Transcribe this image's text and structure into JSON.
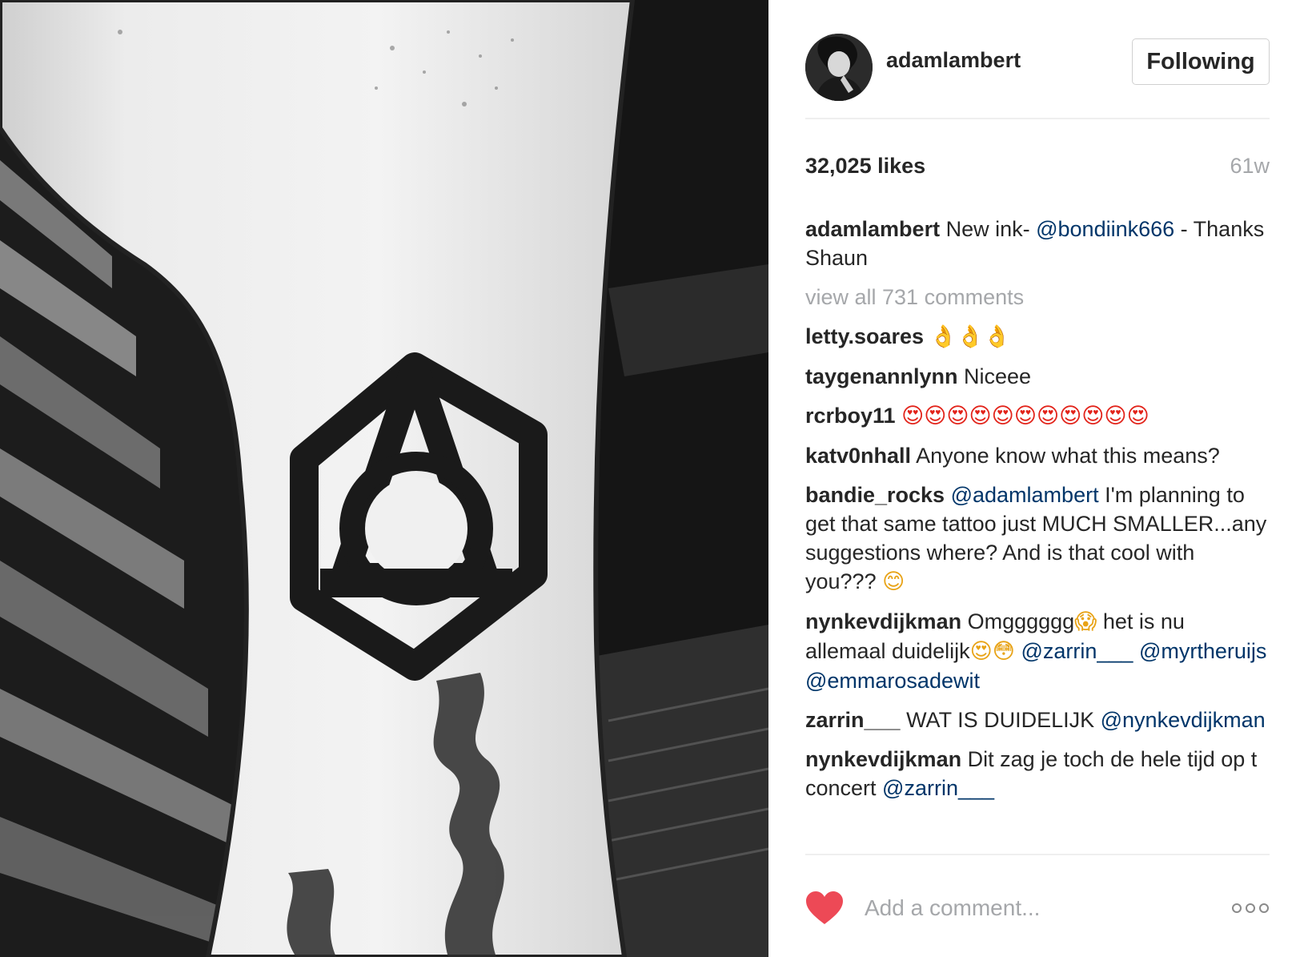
{
  "post": {
    "author": "adamlambert",
    "follow_label": "Following",
    "likes": "32,025 likes",
    "age": "61w",
    "caption": {
      "author": "adamlambert",
      "text_1": " New ink- ",
      "mention": "@bondiink666",
      "text_2": " - Thanks Shaun"
    },
    "view_all": "view all 731 comments"
  },
  "comments": [
    {
      "author": "letty.soares",
      "text": " ",
      "emoji": "👌👌👌"
    },
    {
      "author": "taygenannlynn",
      "text": " Niceee"
    },
    {
      "author": "rcrboy11",
      "text": " ",
      "emoji": "😍😍😍😍😍😍😍😍😍😍😍"
    },
    {
      "author": "katv0nhall",
      "text": " Anyone know what this means?"
    },
    {
      "author": "bandie_rocks",
      "mention": "@adamlambert",
      "text": " I'm planning to get that same tattoo just MUCH SMALLER...any suggestions where? And is that cool with you??? ",
      "emoji": "😊"
    },
    {
      "author": "nynkevdijkman",
      "text_1": " Omgggggg",
      "emoji_1": "😱",
      "text_2": " het is nu allemaal duidelijk",
      "emoji_2": "😍😳",
      "mention_1": "@zarrin___",
      "mention_2": "@myrtheruijs",
      "mention_3": "@emmarosadewit"
    },
    {
      "author": "zarrin___",
      "text": " WAT IS DUIDELIJK ",
      "mention": "@nynkevdijkman"
    },
    {
      "author": "nynkevdijkman",
      "text": " Dit zag je toch de hele tijd op t concert ",
      "mention": "@zarrin___"
    }
  ],
  "footer": {
    "comment_placeholder": "Add a comment..."
  },
  "icons": {
    "like": "heart-icon",
    "more": "more-options-icon"
  },
  "colors": {
    "like_heart": "#ed4956",
    "mention": "#003569",
    "muted": "#a5a7aa"
  }
}
